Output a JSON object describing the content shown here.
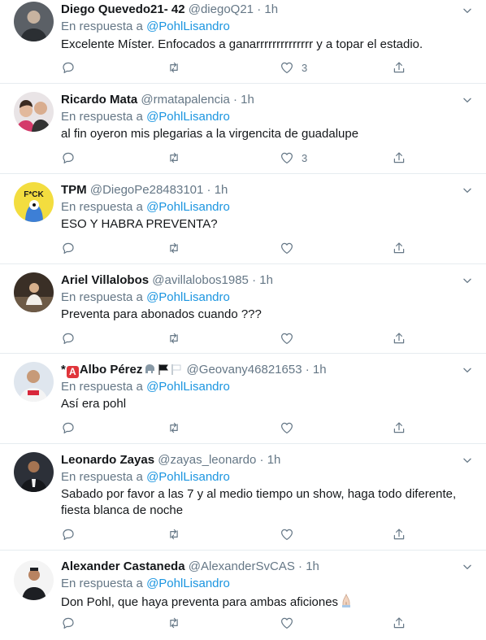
{
  "reply_prefix": "En respuesta a",
  "reply_to": "@PohlLisandro",
  "tweets": [
    {
      "name": "Diego Quevedo21- 42",
      "handle": "@diegoQ21",
      "time": "1h",
      "text": "Excelente Míster. Enfocados a ganarrrrrrrrrrrrrr y a topar el estadio.",
      "replies": "",
      "retweets": "",
      "likes": "3"
    },
    {
      "name": "Ricardo Mata",
      "handle": "@rmatapalencia",
      "time": "1h",
      "text": "al fin oyeron mis plegarias a la virgencita de guadalupe",
      "replies": "",
      "retweets": "",
      "likes": "3"
    },
    {
      "name": "TPM",
      "handle": "@DiegoPe28483101",
      "time": "1h",
      "text": "ESO Y HABRA PREVENTA?",
      "avatar_text": "F*CK",
      "replies": "",
      "retweets": "",
      "likes": ""
    },
    {
      "name": "Ariel Villalobos",
      "handle": "@avillalobos1985",
      "time": "1h",
      "text": "Preventa para abonados cuando ???",
      "replies": "",
      "retweets": "",
      "likes": ""
    },
    {
      "name_prefix": "*",
      "name_badge": "A",
      "name": "Albo Pérez",
      "handle": "@Geovany46821653",
      "time": "1h",
      "text": "Así era pohl",
      "replies": "",
      "retweets": "",
      "likes": ""
    },
    {
      "name": "Leonardo Zayas",
      "handle": "@zayas_leonardo",
      "time": "1h",
      "text": "Sabado por favor a las 7 y al medio  tiempo un show, haga todo diferente, fiesta blanca de noche",
      "replies": "",
      "retweets": "",
      "likes": ""
    },
    {
      "name": "Alexander Castaneda",
      "handle": "@AlexanderSvCAS",
      "time": "1h",
      "text": "Don Pohl, que haya preventa para ambas aficiones",
      "replies": "",
      "retweets": "",
      "likes": ""
    }
  ],
  "icons": {
    "caret": "chevron-down-icon",
    "reply": "reply-icon",
    "retweet": "retweet-icon",
    "like": "heart-icon",
    "share": "share-icon"
  },
  "colors": {
    "link": "#1b95e0",
    "muted": "#657786",
    "text": "#14171a",
    "divider": "#e6ecf0"
  }
}
